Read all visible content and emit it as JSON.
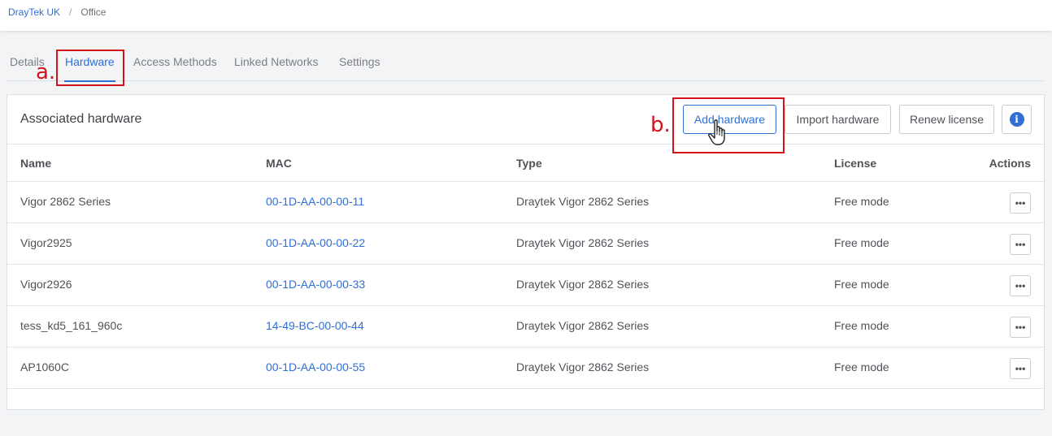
{
  "breadcrumb": {
    "root": "DrayTek UK",
    "separator": "/",
    "current": "Office"
  },
  "tabs": [
    {
      "label": "Details",
      "active": false
    },
    {
      "label": "Hardware",
      "active": true
    },
    {
      "label": "Access Methods",
      "active": false
    },
    {
      "label": "Linked Networks",
      "active": false
    },
    {
      "label": "Settings",
      "active": false
    }
  ],
  "annotations": {
    "a": "a.",
    "b": "b."
  },
  "panel": {
    "title": "Associated hardware",
    "buttons": {
      "add": "Add hardware",
      "import": "Import hardware",
      "renew": "Renew license",
      "info_icon": "info-icon"
    }
  },
  "table": {
    "headers": {
      "name": "Name",
      "mac": "MAC",
      "type": "Type",
      "license": "License",
      "actions": "Actions"
    },
    "rows": [
      {
        "name": "Vigor 2862 Series",
        "mac": "00-1D-AA-00-00-11",
        "type": "Draytek Vigor 2862 Series",
        "license": "Free mode"
      },
      {
        "name": "Vigor2925",
        "mac": "00-1D-AA-00-00-22",
        "type": "Draytek Vigor 2862 Series",
        "license": "Free mode"
      },
      {
        "name": "Vigor2926",
        "mac": "00-1D-AA-00-00-33",
        "type": "Draytek Vigor 2862 Series",
        "license": "Free mode"
      },
      {
        "name": "tess_kd5_161_960c",
        "mac": "14-49-BC-00-00-44",
        "type": "Draytek Vigor 2862 Series",
        "license": "Free mode"
      },
      {
        "name": "AP1060C",
        "mac": "00-1D-AA-00-00-55",
        "type": "Draytek Vigor 2862 Series",
        "license": "Free mode"
      }
    ],
    "row_action_icon": "more-options-icon"
  },
  "colors": {
    "accent": "#2f6fd6",
    "annotation": "#d4121b",
    "background": "#f3f4f6"
  }
}
